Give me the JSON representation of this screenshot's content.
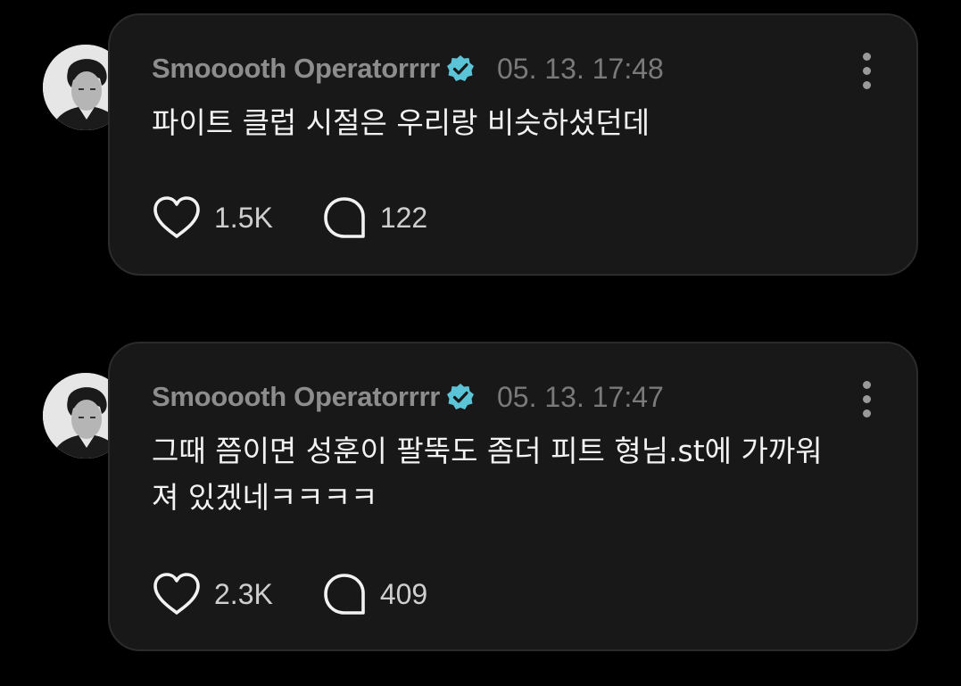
{
  "posts": [
    {
      "username": "Smooooth Operatorrrr",
      "verified_icon": "verified-badge-icon",
      "verified_color": "#5bc4d6",
      "timestamp": "05. 13. 17:48",
      "text": "파이트 클럽 시절은 우리랑 비슷하셨던데",
      "likes": "1.5K",
      "comments": "122"
    },
    {
      "username": "Smooooth Operatorrrr",
      "verified_icon": "verified-badge-icon",
      "verified_color": "#5bc4d6",
      "timestamp": "05. 13. 17:47",
      "text": "그때 쯤이면 성훈이 팔뚝도 좀더 피트 형님.st에 가까워져 있겠네ㅋㅋㅋㅋ",
      "likes": "2.3K",
      "comments": "409"
    }
  ],
  "icons": {
    "like": "heart-icon",
    "comment": "speech-bubble-icon",
    "menu": "more-vertical-icon"
  }
}
